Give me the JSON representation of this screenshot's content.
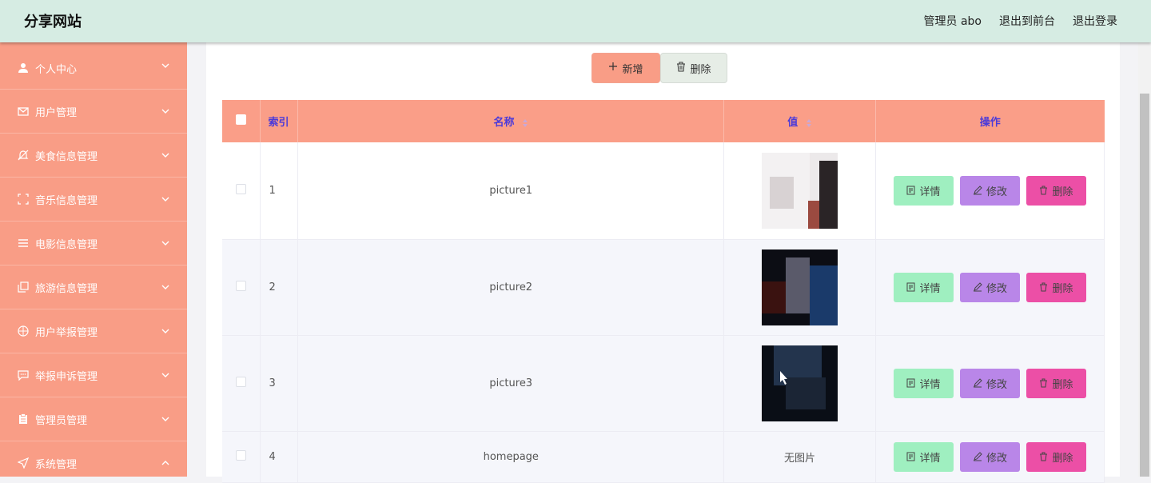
{
  "header": {
    "title": "分享网站",
    "user": "管理员 abo",
    "front_link": "退出到前台",
    "logout": "退出登录"
  },
  "sidebar": {
    "items": [
      {
        "label": "个人中心",
        "icon": "user-icon"
      },
      {
        "label": "用户管理",
        "icon": "mail-icon"
      },
      {
        "label": "美食信息管理",
        "icon": "bell-off-icon"
      },
      {
        "label": "音乐信息管理",
        "icon": "frame-icon"
      },
      {
        "label": "电影信息管理",
        "icon": "menu-icon"
      },
      {
        "label": "旅游信息管理",
        "icon": "copy-icon"
      },
      {
        "label": "用户举报管理",
        "icon": "globe-icon"
      },
      {
        "label": "举报申诉管理",
        "icon": "chat-icon"
      },
      {
        "label": "管理员管理",
        "icon": "clipboard-icon"
      },
      {
        "label": "系统管理",
        "icon": "send-icon"
      }
    ]
  },
  "toolbar": {
    "add_label": "新增",
    "delete_label": "删除"
  },
  "table": {
    "headers": {
      "index": "索引",
      "name": "名称",
      "value": "值",
      "actions": "操作"
    },
    "rows": [
      {
        "index": "1",
        "name": "picture1",
        "value": "",
        "has_image": true
      },
      {
        "index": "2",
        "name": "picture2",
        "value": "",
        "has_image": true
      },
      {
        "index": "3",
        "name": "picture3",
        "value": "",
        "has_image": true
      },
      {
        "index": "4",
        "name": "homepage",
        "value": "无图片",
        "has_image": false
      }
    ],
    "actions": {
      "detail": "详情",
      "edit": "修改",
      "remove": "删除"
    }
  },
  "colors": {
    "header_bg": "#d6ece3",
    "sidebar_bg": "#f99d86",
    "table_header_bg": "#fa9e88",
    "detail_btn": "#9fefc0",
    "edit_btn": "#b986e8",
    "remove_btn": "#ec4fa6"
  }
}
